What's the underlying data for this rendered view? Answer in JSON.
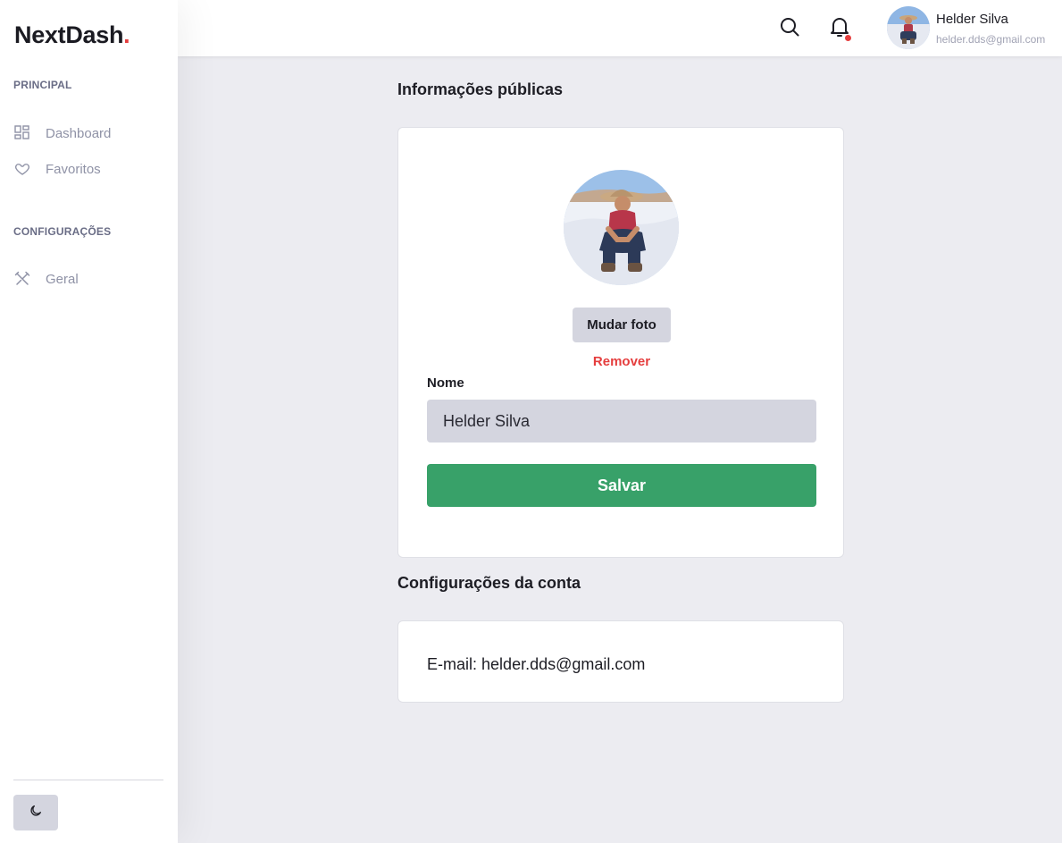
{
  "app": {
    "logo_text": "NextDash",
    "logo_dot": "."
  },
  "sidebar": {
    "sections": [
      {
        "label": "PRINCIPAL",
        "items": [
          {
            "label": "Dashboard",
            "icon": "grid-icon"
          },
          {
            "label": "Favoritos",
            "icon": "heart-icon"
          }
        ]
      },
      {
        "label": "CONFIGURAÇÕES",
        "items": [
          {
            "label": "Geral",
            "icon": "tools-icon"
          }
        ]
      }
    ],
    "theme_toggle_icon": "moon-icon"
  },
  "header": {
    "search_icon": "search-icon",
    "notification_icon": "bell-icon",
    "has_notification": true,
    "user": {
      "name": "Helder Silva",
      "email": "helder.dds@gmail.com"
    }
  },
  "public_info": {
    "title": "Informações públicas",
    "change_photo_label": "Mudar foto",
    "remove_label": "Remover",
    "name_label": "Nome",
    "name_value": "Helder Silva",
    "save_label": "Salvar"
  },
  "account": {
    "title": "Configurações da conta",
    "email_prefix": "E-mail:",
    "email": "helder.dds@gmail.com"
  },
  "colors": {
    "accent_red": "#e53e3e",
    "save_green": "#38a169",
    "muted_button": "#d4d5df",
    "background": "#ececf1"
  }
}
